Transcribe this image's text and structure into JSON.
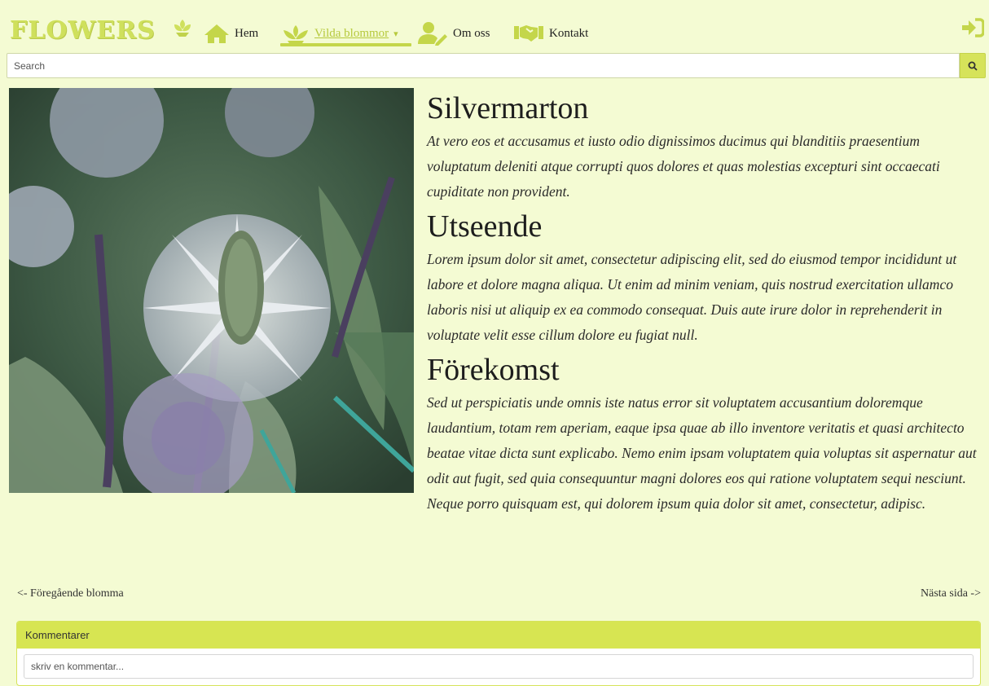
{
  "logo": {
    "text": "FLOWERS"
  },
  "nav": {
    "items": [
      {
        "label": "Hem",
        "icon": "home-icon"
      },
      {
        "label": "Vilda blommor",
        "icon": "lotus-icon",
        "caret": "▾"
      },
      {
        "label": "Om oss",
        "icon": "user-edit-icon"
      },
      {
        "label": "Kontakt",
        "icon": "handshake-icon"
      }
    ],
    "login_icon": "sign-in-icon"
  },
  "search": {
    "placeholder": "Search",
    "button_icon": "search-icon"
  },
  "article": {
    "image_alt": "Silvermarton",
    "title": "Silvermarton",
    "intro": "At vero eos et accusamus et iusto odio dignissimos ducimus qui blanditiis praesentium voluptatum deleniti atque corrupti quos dolores et quas molestias excepturi sint occaecati cupiditate non provident.",
    "sections": [
      {
        "heading": "Utseende",
        "text": "Lorem ipsum dolor sit amet, consectetur adipiscing elit, sed do eiusmod tempor incididunt ut labore et dolore magna aliqua. Ut enim ad minim veniam, quis nostrud exercitation ullamco laboris nisi ut aliquip ex ea commodo consequat. Duis aute irure dolor in reprehenderit in voluptate velit esse cillum dolore eu fugiat null."
      },
      {
        "heading": "Förekomst",
        "text": "Sed ut perspiciatis unde omnis iste natus error sit voluptatem accusantium doloremque laudantium, totam rem aperiam, eaque ipsa quae ab illo inventore veritatis et quasi architecto beatae vitae dicta sunt explicabo. Nemo enim ipsam voluptatem quia voluptas sit aspernatur aut odit aut fugit, sed quia consequuntur magni dolores eos qui ratione voluptatem sequi nesciunt. Neque porro quisquam est, qui dolorem ipsum quia dolor sit amet, consectetur, adipisc."
      }
    ]
  },
  "pager": {
    "prev": "<- Föregående blomma",
    "next": "Nästa sida ->"
  },
  "comments": {
    "heading": "Kommentarer",
    "placeholder": "skriv en kommentar..."
  },
  "colors": {
    "accent": "#d7e552",
    "background": "#f4fbd3",
    "active_link": "#b6c93c"
  }
}
